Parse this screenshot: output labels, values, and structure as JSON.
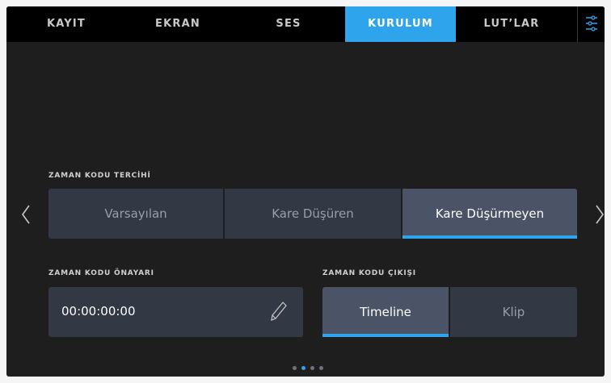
{
  "tabs": [
    "KAYIT",
    "EKRAN",
    "SES",
    "KURULUM",
    "LUT’LAR"
  ],
  "active_tab": "KURULUM",
  "icons": {
    "menu": "sliders-icon",
    "prev": "chevron-left-icon",
    "next": "chevron-right-icon",
    "edit": "pencil-icon"
  },
  "colors": {
    "accent": "#2ea4ec",
    "panel": "#1e1e1e",
    "topbar": "#000000",
    "segment": "#323844",
    "segment_selected": "#4a5466"
  },
  "timecode_pref": {
    "label": "ZAMAN KODU TERCİHİ",
    "options": [
      "Varsayılan",
      "Kare Düşüren",
      "Kare Düşürmeyen"
    ],
    "selected": "Kare Düşürmeyen"
  },
  "timecode_preset": {
    "label": "ZAMAN KODU ÖNAYARI",
    "value": "00:00:00:00"
  },
  "timecode_output": {
    "label": "ZAMAN KODU ÇIKIŞI",
    "options": [
      "Timeline",
      "Klip"
    ],
    "selected": "Timeline"
  },
  "page_indicator": {
    "total": 4,
    "current": 2
  }
}
